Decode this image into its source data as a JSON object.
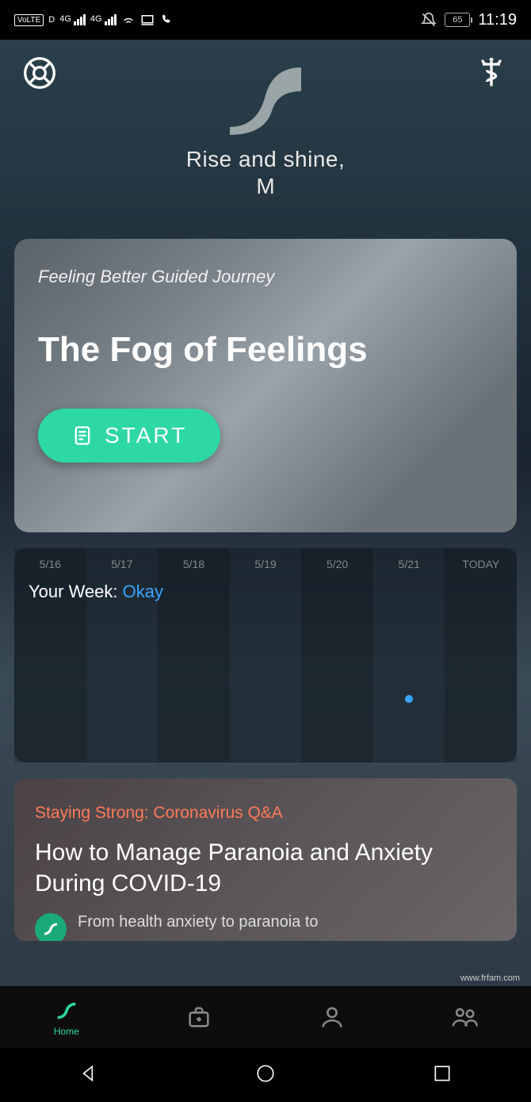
{
  "status": {
    "volte": "VoLTE",
    "d": "D",
    "net1": "4G",
    "net2": "4G",
    "battery": "65",
    "time": "11:19"
  },
  "greeting": {
    "line1": "Rise and shine,",
    "name": "M"
  },
  "journey": {
    "subtitle": "Feeling Better Guided Journey",
    "title": "The Fog of Feelings",
    "start_label": "START"
  },
  "week": {
    "days": [
      "5/16",
      "5/17",
      "5/18",
      "5/19",
      "5/20",
      "5/21",
      "TODAY"
    ],
    "label": "Your Week: ",
    "status": "Okay",
    "dot_index": 5
  },
  "article": {
    "tag": "Staying Strong: Coronavirus Q&A",
    "title": "How to Manage Paranoia and Anxiety During COVID-19",
    "desc": "From health anxiety to paranoia to"
  },
  "nav": {
    "home": "Home"
  },
  "watermark": "www.frfam.com"
}
